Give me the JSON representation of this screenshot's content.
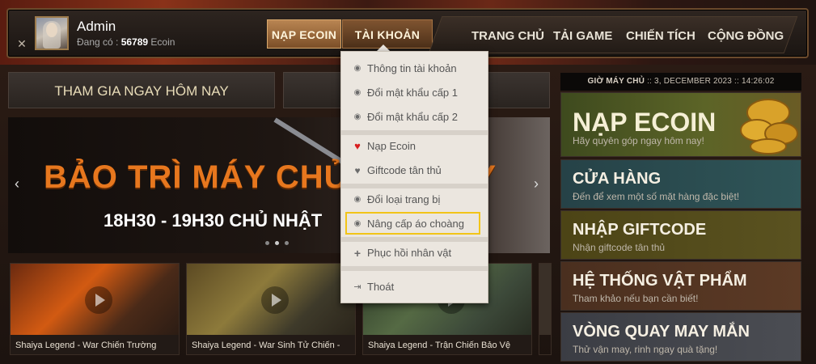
{
  "header": {
    "close_glyph": "✕",
    "user": {
      "name": "Admin",
      "balance_label": "Đang có : ",
      "balance_amount": "56789",
      "balance_unit": " Ecoin"
    },
    "tabs": {
      "nap_ecoin": "NẠP ECOIN",
      "tai_khoan": "TÀI KHOẢN"
    },
    "nav": {
      "trang_chu": "TRANG CHỦ",
      "tai_game": "TẢI GAME",
      "chien_tich": "CHIẾN TÍCH",
      "cong_dong": "CỘNG ĐỒNG"
    }
  },
  "account_menu": {
    "items": [
      {
        "label": "Thông tin tài khoản",
        "icon": "circle-dot-icon"
      },
      {
        "label": "Đổi mật khẩu cấp 1",
        "icon": "circle-dot-icon"
      },
      {
        "label": "Đổi mật khẩu cấp 2",
        "icon": "circle-dot-icon"
      },
      {
        "label": "Nạp Ecoin",
        "icon": "heart-icon"
      },
      {
        "label": "Giftcode tân thủ",
        "icon": "heart-icon"
      },
      {
        "label": "Đổi loại trang bị",
        "icon": "circle-dot-icon"
      },
      {
        "label": "Nâng cấp áo choàng",
        "icon": "circle-dot-icon"
      },
      {
        "label": "Phục hồi nhân vật",
        "icon": "plus-icon"
      },
      {
        "label": "Thoát",
        "icon": "logout-icon"
      }
    ],
    "highlighted_item": "Nâng cấp áo choàng",
    "highlight_color": "#f2c418"
  },
  "main": {
    "join_button": "THAM GIA NGAY HÔM NAY",
    "banner": {
      "title": "BẢO TRÌ MÁY CHỦ ĐỊNH KỲ",
      "subtitle": "18H30 - 19H30 CHỦ NHẬT",
      "prev_glyph": "‹",
      "next_glyph": "›"
    },
    "videos": [
      {
        "caption": "Shaiya Legend - War Chiến Trường"
      },
      {
        "caption": "Shaiya Legend - War Sinh Tử Chiến -"
      },
      {
        "caption": "Shaiya Legend - Trận Chiến Bảo Vệ"
      }
    ]
  },
  "sidebar": {
    "server_time_label": "GIỜ MÁY CHỦ",
    "server_time_value": " :: 3, DECEMBER 2023 :: 14:26:02",
    "cards": {
      "nap": {
        "title": "NẠP ECOIN",
        "subtitle": "Hãy quyên góp ngay hôm nay!"
      },
      "shop": {
        "title": "CỬA HÀNG",
        "subtitle": "Đến để xem một số mặt hàng đặc biệt!"
      },
      "gift": {
        "title": "NHẬP GIFTCODE",
        "subtitle": "Nhận giftcode tân thủ"
      },
      "items": {
        "title": "HỆ THỐNG VẬT PHẨM",
        "subtitle": "Tham khảo nếu bạn cần biết!"
      },
      "spin": {
        "title": "VÒNG QUAY MAY MẮN",
        "subtitle": "Thử vận may, rinh ngay quà tặng!"
      }
    }
  }
}
